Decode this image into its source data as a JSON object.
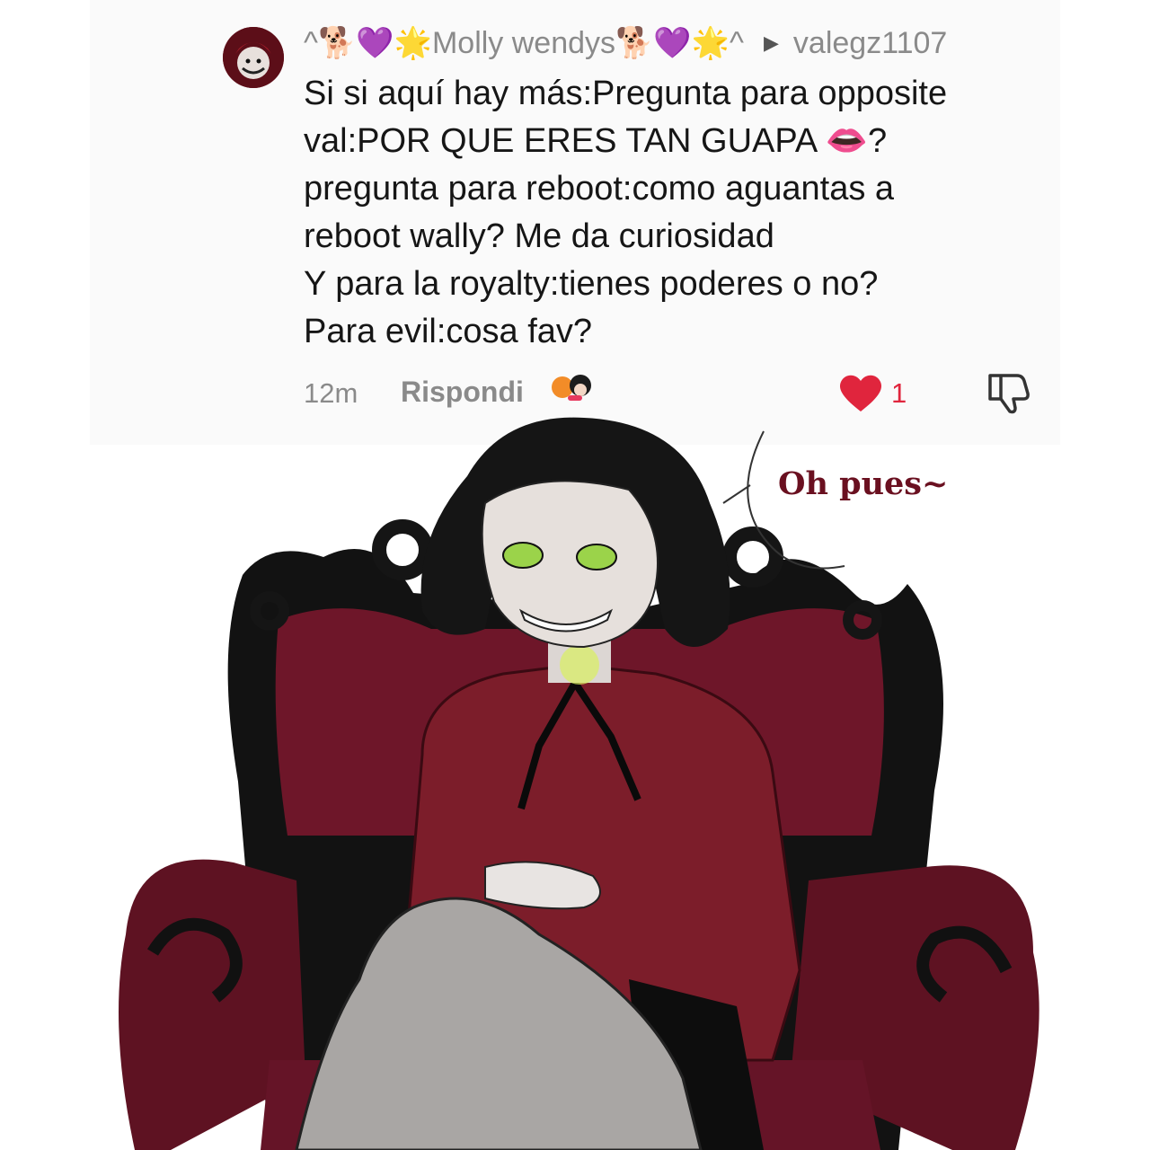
{
  "comment": {
    "username": "^🐕💜🌟Molly wendys🐕💜🌟^",
    "reply_to": "valegz1107",
    "lines": [
      "Si si aquí hay más:Pregunta para opposite",
      "val:POR QUE ERES TAN GUAPA 👄?",
      "pregunta para reboot:como aguantas a",
      "reboot wally? Me da curiosidad",
      "Y para la royalty:tienes poderes o no?",
      "Para evil:cosa fav?"
    ],
    "time": "12m",
    "reply_label": "Rispondi",
    "like_count": "1"
  },
  "icons": {
    "reply_arrow": "play-arrow-icon",
    "like": "heart-icon",
    "dislike": "thumbs-down-icon"
  },
  "colors": {
    "like_red": "#e0253d",
    "speech_text": "#6a1020",
    "chair": "#7a1a30",
    "shirt": "#7c1d2a"
  },
  "illustration": {
    "speech": "Oh pues~"
  }
}
